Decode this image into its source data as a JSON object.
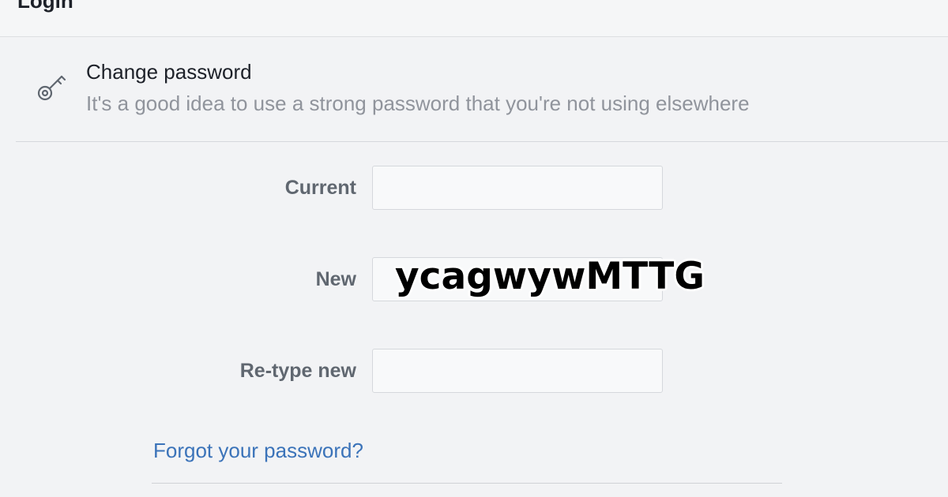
{
  "header": {
    "title": "Login"
  },
  "change_password": {
    "icon": "key-icon",
    "title": "Change password",
    "subtitle": "It's a good idea to use a strong password that you're not using elsewhere"
  },
  "form": {
    "current_label": "Current",
    "current_value": "",
    "new_label": "New",
    "new_value": "",
    "retype_label": "Re-type new",
    "retype_value": "",
    "overlay_text": "ycagwywMTTG"
  },
  "links": {
    "forgot_password": "Forgot your password?"
  },
  "colors": {
    "link": "#3b73b9",
    "label": "#606770",
    "muted": "#90949c",
    "background": "#f2f3f5"
  }
}
